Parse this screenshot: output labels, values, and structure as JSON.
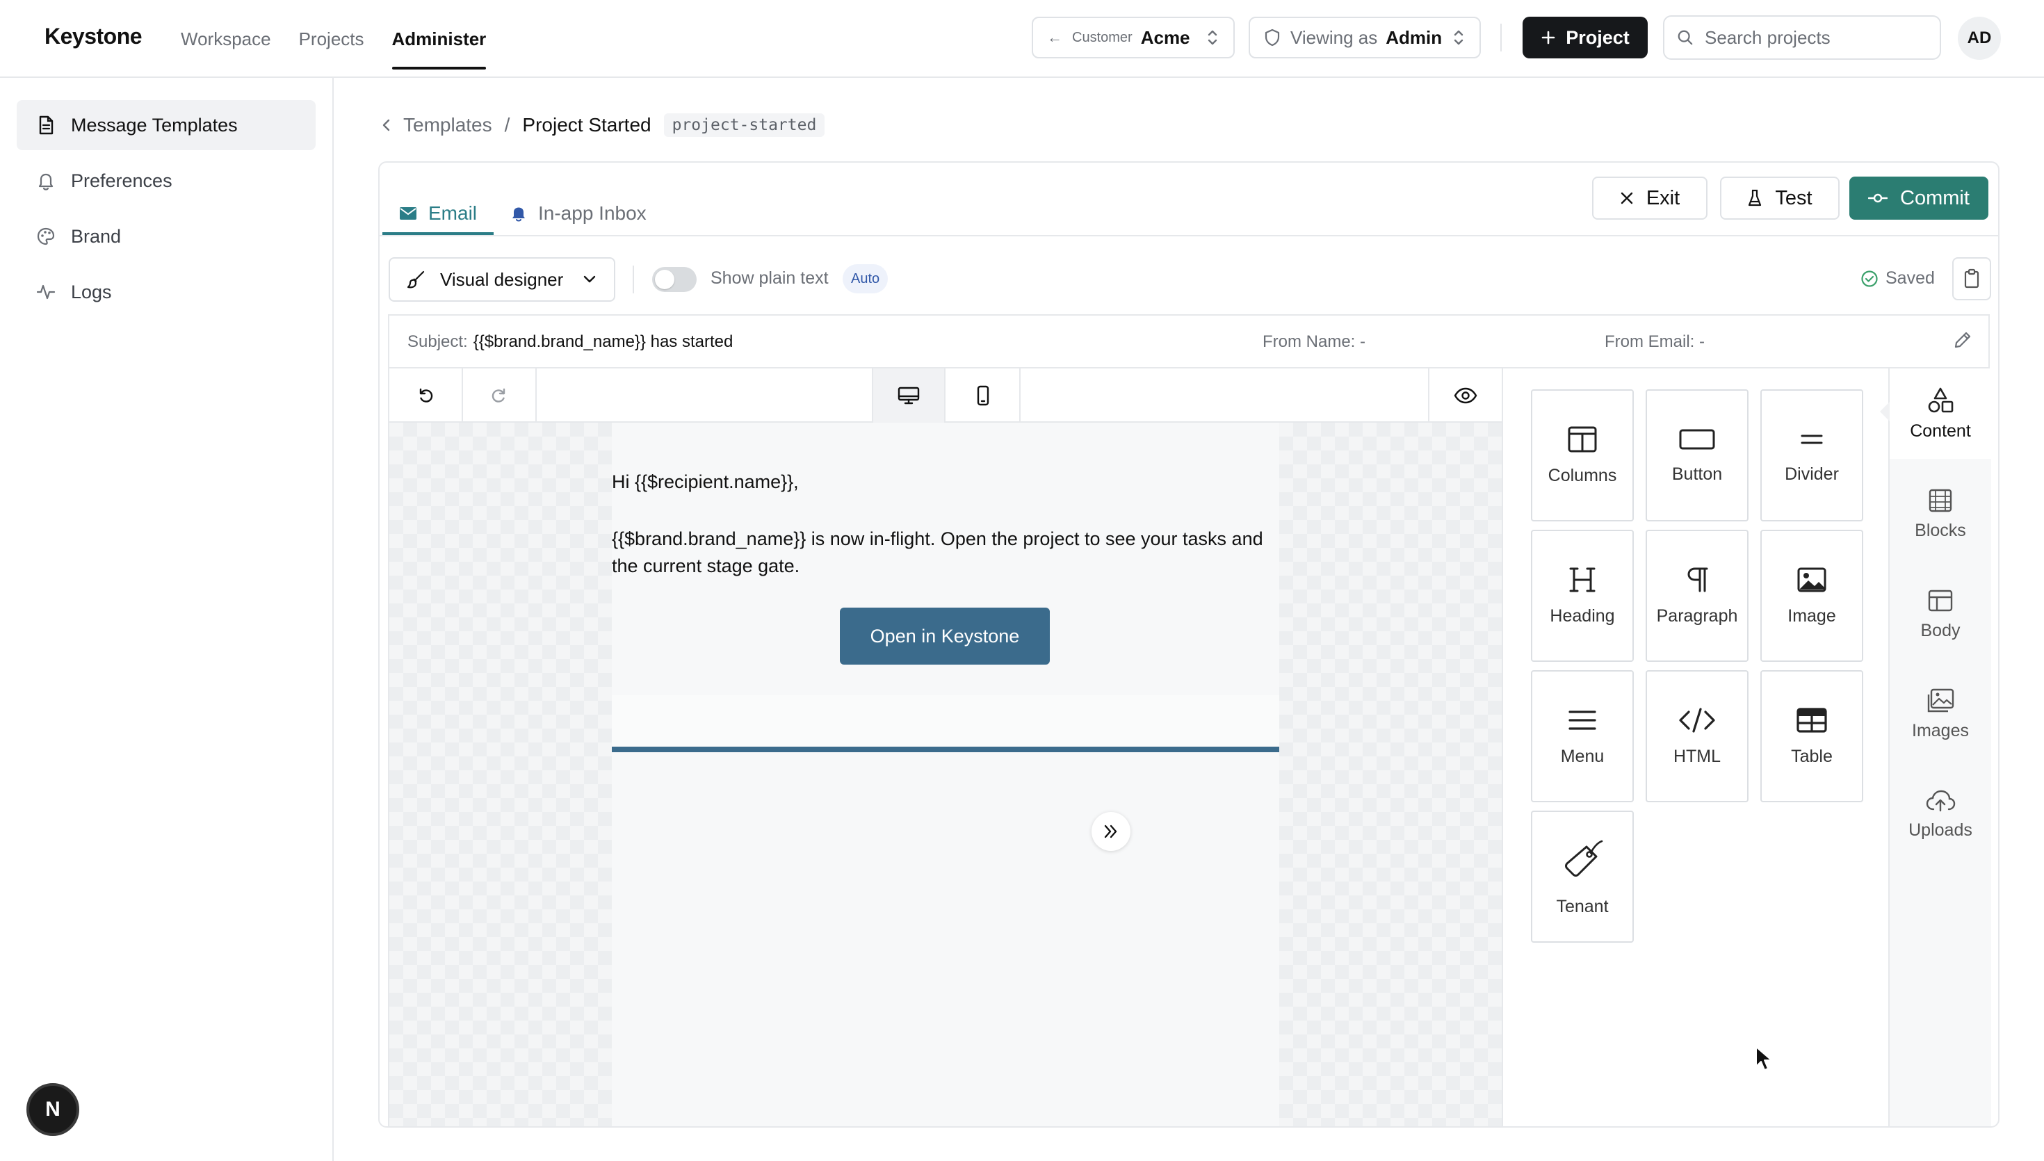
{
  "app": {
    "logo": "Keystone",
    "nav": [
      "Workspace",
      "Projects",
      "Administer"
    ],
    "active_nav": "Administer"
  },
  "header": {
    "customer_back": "←",
    "customer_label": "Customer",
    "customer_value": "Acme",
    "viewing_label": "Viewing as",
    "viewing_value": "Admin",
    "project_button": "Project",
    "search_placeholder": "Search projects",
    "avatar_initials": "AD"
  },
  "sidebar": {
    "items": [
      {
        "label": "Message Templates",
        "icon": "document-icon",
        "active": true
      },
      {
        "label": "Preferences",
        "icon": "bell-icon",
        "active": false
      },
      {
        "label": "Brand",
        "icon": "palette-icon",
        "active": false
      },
      {
        "label": "Logs",
        "icon": "activity-icon",
        "active": false
      }
    ],
    "fab_label": "N"
  },
  "breadcrumb": {
    "parent": "Templates",
    "separator": "/",
    "current": "Project Started",
    "key": "project-started"
  },
  "editor": {
    "tabs": [
      {
        "label": "Email",
        "icon": "mail-icon",
        "active": true
      },
      {
        "label": "In-app Inbox",
        "icon": "bell-icon",
        "active": false
      }
    ],
    "actions": {
      "exit": "Exit",
      "test": "Test",
      "commit": "Commit"
    },
    "designer_mode": "Visual designer",
    "plain_text_label": "Show plain text",
    "auto_badge": "Auto",
    "save_status": "Saved",
    "subject_label": "Subject:",
    "subject_value": "{{$brand.brand_name}} has started",
    "from_name_label": "From Name:",
    "from_name_value": "-",
    "from_email_label": "From Email:",
    "from_email_value": "-"
  },
  "email_preview": {
    "greeting": "Hi {{$recipient.name}},",
    "body": "{{$brand.brand_name}} is now in-flight. Open the project to see your tasks and the current stage gate.",
    "cta_label": "Open in Keystone",
    "accent_color": "#3b6b8c"
  },
  "tools": {
    "items": [
      {
        "label": "Columns",
        "icon": "columns-icon"
      },
      {
        "label": "Button",
        "icon": "button-icon"
      },
      {
        "label": "Divider",
        "icon": "divider-icon"
      },
      {
        "label": "Heading",
        "icon": "heading-icon"
      },
      {
        "label": "Paragraph",
        "icon": "paragraph-icon"
      },
      {
        "label": "Image",
        "icon": "image-icon"
      },
      {
        "label": "Menu",
        "icon": "menu-icon"
      },
      {
        "label": "HTML",
        "icon": "code-icon"
      },
      {
        "label": "Table",
        "icon": "table-icon"
      },
      {
        "label": "Tenant",
        "icon": "tag-icon"
      }
    ]
  },
  "rail": {
    "items": [
      {
        "label": "Content",
        "icon": "shapes-icon",
        "active": true
      },
      {
        "label": "Blocks",
        "icon": "blocks-icon",
        "active": false
      },
      {
        "label": "Body",
        "icon": "layout-icon",
        "active": false
      },
      {
        "label": "Images",
        "icon": "images-icon",
        "active": false
      },
      {
        "label": "Uploads",
        "icon": "cloud-upload-icon",
        "active": false
      }
    ]
  },
  "colors": {
    "primary_dark": "#16181b",
    "teal_accent": "#2b7d72",
    "tab_active": "#2b7d87"
  }
}
